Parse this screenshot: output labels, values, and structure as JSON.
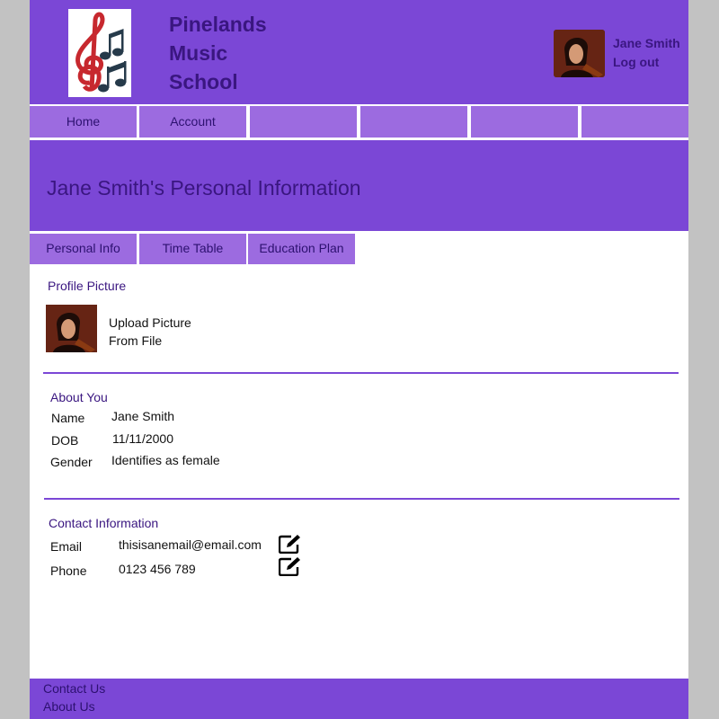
{
  "header": {
    "school_name_line1": "Pinelands",
    "school_name_line2": "Music",
    "school_name_line3": "School",
    "user_name": "Jane Smith",
    "logout_label": "Log out"
  },
  "nav": {
    "items": [
      {
        "label": "Home"
      },
      {
        "label": "Account"
      },
      {
        "label": ""
      },
      {
        "label": ""
      },
      {
        "label": ""
      },
      {
        "label": ""
      }
    ]
  },
  "banner": {
    "title": "Jane Smith's Personal Information"
  },
  "tabs": [
    {
      "label": "Personal Info"
    },
    {
      "label": "Time Table"
    },
    {
      "label": "Education Plan"
    }
  ],
  "profile": {
    "section_title": "Profile Picture",
    "upload_line1": "Upload Picture",
    "upload_line2": "From File"
  },
  "about": {
    "section_title": "About You",
    "fields": [
      {
        "label": "Name",
        "value": "Jane Smith"
      },
      {
        "label": "DOB",
        "value": "11/11/2000"
      },
      {
        "label": "Gender",
        "value": "Identifies as female"
      }
    ]
  },
  "contact": {
    "section_title": "Contact Information",
    "fields": [
      {
        "label": "Email",
        "value": "thisisanemail@email.com"
      },
      {
        "label": "Phone",
        "value": "0123 456 789"
      }
    ]
  },
  "footer": {
    "contact_label": "Contact Us",
    "about_label": "About Us"
  },
  "colors": {
    "brand_purple": "#7b47d6",
    "tab_purple": "#9c6be0",
    "text_dark_purple": "#3a1680",
    "page_background": "#c2c2c2"
  }
}
